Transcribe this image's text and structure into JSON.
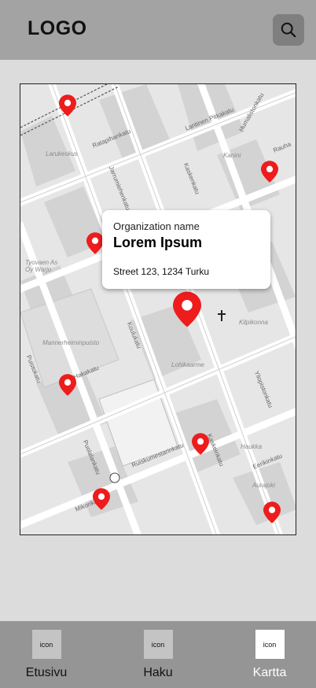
{
  "header": {
    "logo": "LOGO",
    "search_icon": "search-icon"
  },
  "map": {
    "popup": {
      "organization_label": "Organization name",
      "title": "Lorem Ipsum",
      "address": "Street 123, 1234 Turku"
    },
    "pin_color": "#ee1c1c",
    "place_labels": [
      "Larukeskus",
      "Mannerheiminpuisto",
      "Lohikaarme",
      "Kilpikonna",
      "Kanini",
      "Haukka",
      "Tyovaen As Oy Warjo",
      "Aurajoki"
    ],
    "street_labels": [
      "Ratapihankatu",
      "Lantinen Pitkakatu",
      "Humalistonkatu",
      "Kaskenkatu",
      "Jarrumiehenkatu",
      "Koulukatu",
      "Puistokatu",
      "Puolalankatu",
      "Ruiskumestarinkatu",
      "Mikonkatu",
      "Eerikinkatu",
      "Yliopistonkatu",
      "Hakakatu",
      "Rauha",
      "Kaskeinkatu"
    ]
  },
  "nav": {
    "items": [
      {
        "icon": "icon",
        "label": "Etusivu"
      },
      {
        "icon": "icon",
        "label": "Haku"
      },
      {
        "icon": "icon",
        "label": "Kartta"
      }
    ]
  }
}
